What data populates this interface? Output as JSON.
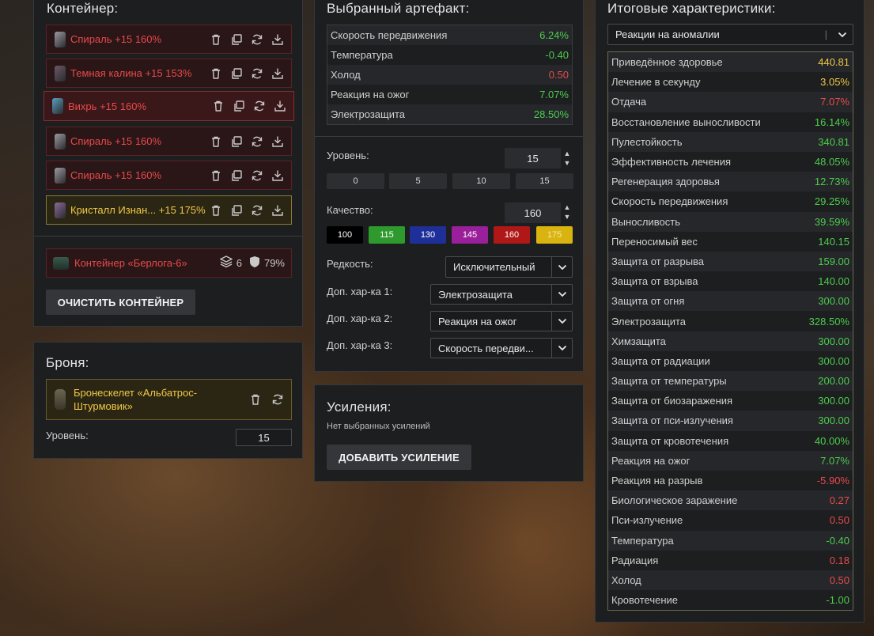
{
  "container": {
    "title": "Контейнер:",
    "artifacts": [
      {
        "name": "Спираль",
        "level": "+15",
        "quality": "160%",
        "color": "#e84a4a"
      },
      {
        "name": "Темная калина",
        "level": "+15",
        "quality": "153%",
        "color": "#e84a4a"
      },
      {
        "name": "Вихрь",
        "level": "+15",
        "quality": "160%",
        "color": "#e84a4a"
      },
      {
        "name": "Спираль",
        "level": "+15",
        "quality": "160%",
        "color": "#e84a4a"
      },
      {
        "name": "Спираль",
        "level": "+15",
        "quality": "160%",
        "color": "#e84a4a"
      },
      {
        "name": "Кристалл Изнан...",
        "level": "+15",
        "quality": "175%",
        "color": "#f0c844"
      }
    ],
    "container_item": {
      "name": "Контейнер «Берлога-6»",
      "slots": "6",
      "protection": "79%"
    },
    "clear_button": "ОЧИСТИТЬ КОНТЕЙНЕР"
  },
  "armor": {
    "title": "Броня:",
    "item_line1": "Бронескелет «Альбатрос-",
    "item_line2": "Штурмовик»",
    "level_label": "Уровень:",
    "level_value": "15"
  },
  "selected_artifact": {
    "title": "Выбранный артефакт:",
    "stats": [
      {
        "label": "Скорость передвижения",
        "value": "6.24%",
        "tone": "pos"
      },
      {
        "label": "Температура",
        "value": "-0.40",
        "tone": "pos"
      },
      {
        "label": "Холод",
        "value": "0.50",
        "tone": "neg"
      },
      {
        "label": "Реакция на ожог",
        "value": "7.07%",
        "tone": "pos"
      },
      {
        "label": "Электрозащита",
        "value": "28.50%",
        "tone": "pos"
      }
    ],
    "level_label": "Уровень:",
    "level_value": "15",
    "level_presets": [
      "0",
      "5",
      "10",
      "15"
    ],
    "quality_label": "Качество:",
    "quality_value": "160",
    "quality_presets": [
      {
        "label": "100",
        "bg": "#000000",
        "fg": "#ffffff"
      },
      {
        "label": "115",
        "bg": "#2e9a2e",
        "fg": "#ffffff"
      },
      {
        "label": "130",
        "bg": "#1f2f9a",
        "fg": "#ffffff"
      },
      {
        "label": "145",
        "bg": "#9a1f9a",
        "fg": "#ffffff"
      },
      {
        "label": "160",
        "bg": "#b01818",
        "fg": "#ffffff"
      },
      {
        "label": "175",
        "bg": "#d9b310",
        "fg": "#f5e9a0"
      }
    ],
    "rarity_label": "Редкость:",
    "rarity_value": "Исключительный",
    "extra1_label": "Доп. хар-ка 1:",
    "extra1_value": "Электрозащита",
    "extra2_label": "Доп. хар-ка 2:",
    "extra2_value": "Реакция на ожог",
    "extra3_label": "Доп. хар-ка 3:",
    "extra3_value": "Скорость передви..."
  },
  "boosts": {
    "title": "Усиления:",
    "empty_text": "Нет выбранных усилений",
    "add_button": "ДОБАВИТЬ УСИЛЕНИЕ"
  },
  "totals": {
    "title": "Итоговые характеристики:",
    "filter_value": "Реакции на аномалии",
    "stats": [
      {
        "label": "Приведённое здоровье",
        "value": "440.81",
        "tone": "gold-t"
      },
      {
        "label": "Лечение в секунду",
        "value": "3.05%",
        "tone": "gold-t"
      },
      {
        "label": "Отдача",
        "value": "7.07%",
        "tone": "neg"
      },
      {
        "label": "Восстановление выносливости",
        "value": "16.14%",
        "tone": "pos"
      },
      {
        "label": "Пулестойкость",
        "value": "340.81",
        "tone": "pos"
      },
      {
        "label": "Эффективность лечения",
        "value": "48.05%",
        "tone": "pos"
      },
      {
        "label": "Регенерация здоровья",
        "value": "12.73%",
        "tone": "pos"
      },
      {
        "label": "Скорость передвижения",
        "value": "29.25%",
        "tone": "pos"
      },
      {
        "label": "Выносливость",
        "value": "39.59%",
        "tone": "pos"
      },
      {
        "label": "Переносимый вес",
        "value": "140.15",
        "tone": "pos"
      },
      {
        "label": "Защита от разрыва",
        "value": "159.00",
        "tone": "pos"
      },
      {
        "label": "Защита от взрыва",
        "value": "140.00",
        "tone": "pos"
      },
      {
        "label": "Защита от огня",
        "value": "300.00",
        "tone": "pos"
      },
      {
        "label": "Электрозащита",
        "value": "328.50%",
        "tone": "pos"
      },
      {
        "label": "Химзащита",
        "value": "300.00",
        "tone": "pos"
      },
      {
        "label": "Защита от радиации",
        "value": "300.00",
        "tone": "pos"
      },
      {
        "label": "Защита от температуры",
        "value": "200.00",
        "tone": "pos"
      },
      {
        "label": "Защита от биозаражения",
        "value": "300.00",
        "tone": "pos"
      },
      {
        "label": "Защита от пси-излучения",
        "value": "300.00",
        "tone": "pos"
      },
      {
        "label": "Защита от кровотечения",
        "value": "40.00%",
        "tone": "pos"
      },
      {
        "label": "Реакция на ожог",
        "value": "7.07%",
        "tone": "pos"
      },
      {
        "label": "Реакция на разрыв",
        "value": "-5.90%",
        "tone": "neg"
      },
      {
        "label": "Биологическое заражение",
        "value": "0.27",
        "tone": "neg"
      },
      {
        "label": "Пси-излучение",
        "value": "0.50",
        "tone": "neg"
      },
      {
        "label": "Температура",
        "value": "-0.40",
        "tone": "pos"
      },
      {
        "label": "Радиация",
        "value": "0.18",
        "tone": "neg"
      },
      {
        "label": "Холод",
        "value": "0.50",
        "tone": "neg"
      },
      {
        "label": "Кровотечение",
        "value": "-1.00",
        "tone": "pos"
      }
    ]
  }
}
